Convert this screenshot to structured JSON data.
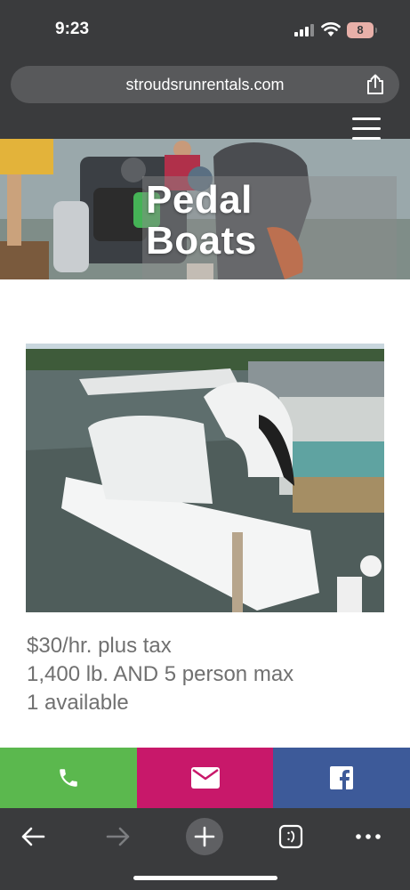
{
  "status_bar": {
    "time": "9:23",
    "battery_level": "8",
    "icons": [
      "cellular-signal-icon",
      "wifi-icon",
      "battery-icon"
    ]
  },
  "browser": {
    "url": "stroudsrunrentals.com",
    "icons": [
      "share-icon",
      "back-arrow-icon",
      "forward-arrow-icon",
      "new-tab-plus-icon",
      "tabs-icon",
      "more-icon"
    ]
  },
  "hero": {
    "title_line1": "Pedal",
    "title_line2": "Boats"
  },
  "product": {
    "price": "$30/hr. plus tax",
    "capacity": "1,400 lb. AND 5 person max",
    "availability": "1 available"
  },
  "contact_bar": {
    "colors": {
      "phone": "#5bb84e",
      "mail": "#c8186a",
      "facebook": "#3d5a99"
    },
    "icons": [
      "phone-icon",
      "mail-icon",
      "facebook-icon"
    ]
  }
}
